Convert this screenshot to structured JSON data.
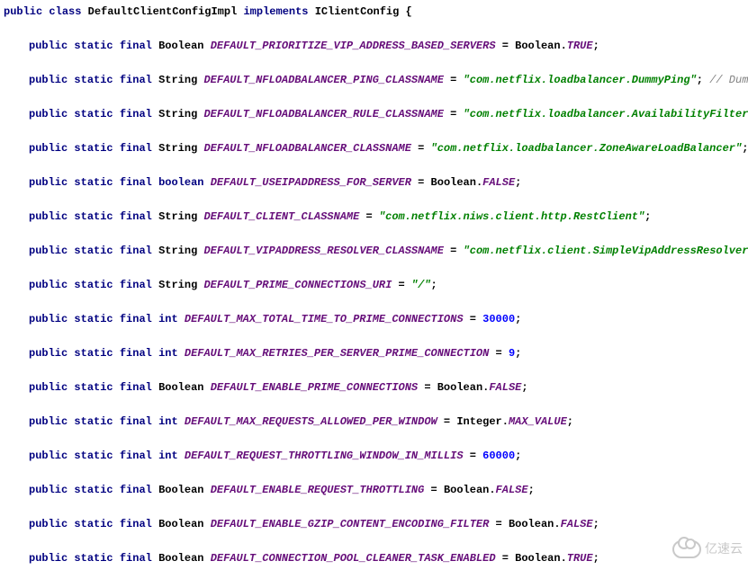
{
  "decl": {
    "k_public": "public",
    "k_class": "class",
    "classname": "DefaultClientConfigImpl",
    "k_implements": "implements",
    "interface": "IClientConfig",
    "brace": "{"
  },
  "kw": {
    "public": "public",
    "static": "static",
    "final": "final",
    "boolean": "boolean",
    "int": "int"
  },
  "t": {
    "Boolean": "Boolean",
    "String": "String",
    "Integer": "Integer"
  },
  "lines": {
    "l1": {
      "name": "DEFAULT_PRIORITIZE_VIP_ADDRESS_BASED_SERVERS",
      "rhs_pfx": "Boolean.",
      "rhs_const": "TRUE"
    },
    "l2": {
      "name": "DEFAULT_NFLOADBALANCER_PING_CLASSNAME",
      "str": "\"com.netflix.loadbalancer.DummyPing\"",
      "comment": "// DummyPing."
    },
    "l3": {
      "name": "DEFAULT_NFLOADBALANCER_RULE_CLASSNAME",
      "str": "\"com.netflix.loadbalancer.AvailabilityFilteringRul"
    },
    "l4": {
      "name": "DEFAULT_NFLOADBALANCER_CLASSNAME",
      "str": "\"com.netflix.loadbalancer.ZoneAwareLoadBalancer\""
    },
    "l5": {
      "name": "DEFAULT_USEIPADDRESS_FOR_SERVER",
      "rhs_pfx": "Boolean.",
      "rhs_const": "FALSE"
    },
    "l6": {
      "name": "DEFAULT_CLIENT_CLASSNAME",
      "str": "\"com.netflix.niws.client.http.RestClient\""
    },
    "l7": {
      "name": "DEFAULT_VIPADDRESS_RESOLVER_CLASSNAME",
      "str": "\"com.netflix.client.SimpleVipAddressResolver\""
    },
    "l8": {
      "name": "DEFAULT_PRIME_CONNECTIONS_URI",
      "str": "\"/\""
    },
    "l9": {
      "name": "DEFAULT_MAX_TOTAL_TIME_TO_PRIME_CONNECTIONS",
      "num": "30000"
    },
    "l10": {
      "name": "DEFAULT_MAX_RETRIES_PER_SERVER_PRIME_CONNECTION",
      "num": "9"
    },
    "l11": {
      "name": "DEFAULT_ENABLE_PRIME_CONNECTIONS",
      "rhs_pfx": "Boolean.",
      "rhs_const": "FALSE"
    },
    "l12": {
      "name": "DEFAULT_MAX_REQUESTS_ALLOWED_PER_WINDOW",
      "rhs_pfx": "Integer.",
      "rhs_const": "MAX_VALUE"
    },
    "l13": {
      "name": "DEFAULT_REQUEST_THROTTLING_WINDOW_IN_MILLIS",
      "num": "60000"
    },
    "l14": {
      "name": "DEFAULT_ENABLE_REQUEST_THROTTLING",
      "rhs_pfx": "Boolean.",
      "rhs_const": "FALSE"
    },
    "l15": {
      "name": "DEFAULT_ENABLE_GZIP_CONTENT_ENCODING_FILTER",
      "rhs_pfx": "Boolean.",
      "rhs_const": "FALSE"
    },
    "l16": {
      "name": "DEFAULT_CONNECTION_POOL_CLEANER_TASK_ENABLED",
      "rhs_pfx": "Boolean.",
      "rhs_const": "TRUE"
    }
  },
  "watermark": "亿速云"
}
